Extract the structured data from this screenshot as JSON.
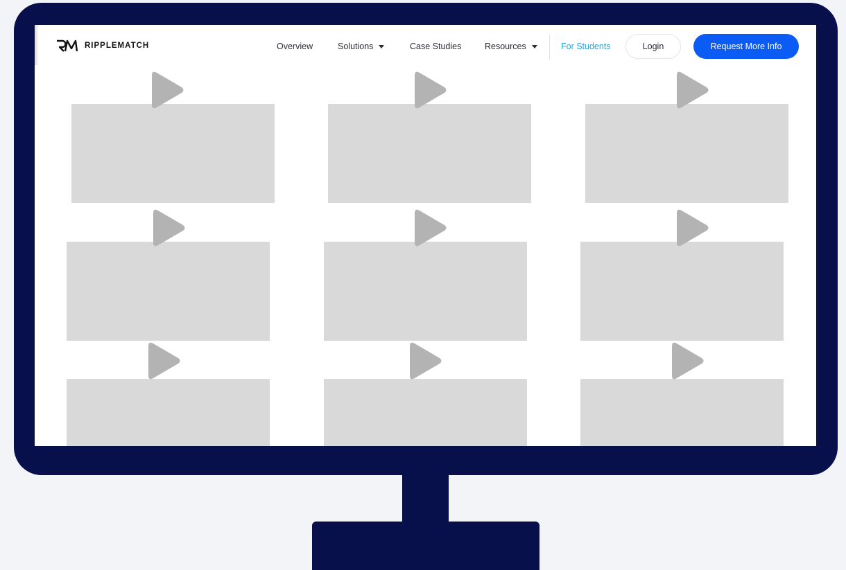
{
  "brand": {
    "logo_icon": "rm-logo-icon",
    "name": "RIPPLEMATCH"
  },
  "nav": {
    "overview": "Overview",
    "solutions": "Solutions",
    "case_studies": "Case Studies",
    "resources": "Resources",
    "for_students": "For Students",
    "login": "Login",
    "request_info": "Request More Info"
  },
  "videos": {
    "count": 9,
    "icon": "play-icon"
  },
  "colors": {
    "monitor_frame": "#07104a",
    "primary_button": "#0b5cf5",
    "students_link": "#29a3dc",
    "video_placeholder": "#d9d9d9",
    "play_icon": "#b3b3b3"
  }
}
